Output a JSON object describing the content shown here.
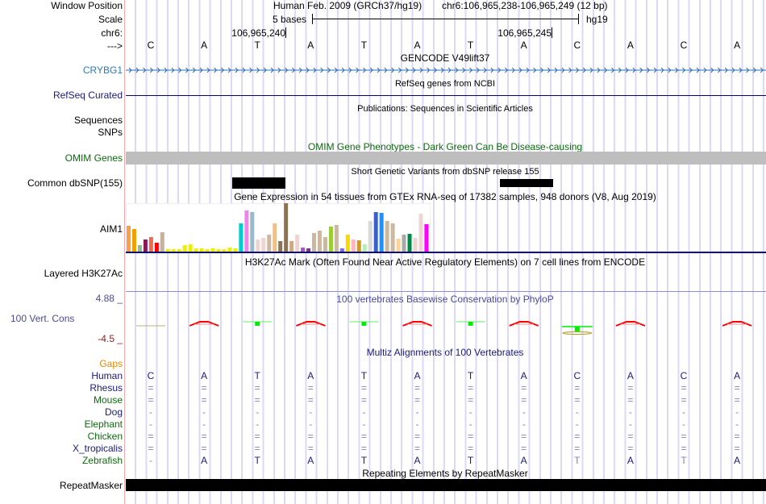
{
  "header": {
    "window_position_label": "Window Position",
    "assembly": "Human Feb. 2009 (GRCh37/hg19)",
    "position": "chr6:106,965,238-106,965,249 (12 bp)",
    "scale_label": "Scale",
    "scale_text": "5 bases",
    "scale_db": "hg19",
    "chrom_label": "chr6:",
    "coord1": "106,965,240",
    "coord2": "106,965,245",
    "strand_label": "--->",
    "bases": [
      "C",
      "A",
      "T",
      "A",
      "T",
      "A",
      "T",
      "A",
      "C",
      "A",
      "C",
      "A"
    ]
  },
  "tracks": {
    "gencode_title": "GENCODE V49lift37",
    "gencode_label": "CRYBG1",
    "refseq_title": "RefSeq genes from NCBI",
    "refseq_label": "RefSeq Curated",
    "pubs_title": "Publications: Sequences in Scientific Articles",
    "pubs_label1": "Sequences",
    "pubs_label2": "SNPs",
    "omim_title": "OMIM Gene Phenotypes - Dark Green Can Be Disease-causing",
    "omim_label": "OMIM Genes",
    "dbsnp_title": "Short Genetic Variants from dbSNP release 155",
    "dbsnp_label": "Common dbSNP(155)",
    "gtex_title": "Gene Expression in 54 tissues from GTEx RNA-seq of 17382 samples, 948 donors (V8, Aug 2019)",
    "gtex_label": "AIM1",
    "h3k27_title": "H3K27Ac Mark (Often Found Near Active Regulatory Elements) on 7 cell lines from ENCODE",
    "h3k27_label": "Layered H3K27Ac",
    "phylop_title": "100 vertebrates Basewise Conservation by PhyloP",
    "phylop_label": "100 Vert. Cons",
    "phylop_max": "4.88 _",
    "phylop_min": "-4.5 _",
    "multiz_title": "Multiz Alignments of 100 Vertebrates",
    "gaps_label": "Gaps",
    "rmsk_title": "Repeating Elements by RepeatMasker",
    "rmsk_label": "RepeatMasker"
  },
  "gtex_values": [
    96,
    84,
    24,
    45,
    54,
    33,
    72,
    9,
    9,
    9,
    24,
    27,
    12,
    12,
    9,
    12,
    9,
    9,
    15,
    12,
    105,
    153,
    147,
    45,
    51,
    63,
    105,
    39,
    180,
    39,
    63,
    15,
    12,
    69,
    78,
    54,
    93,
    99,
    12,
    63,
    45,
    42,
    27,
    114,
    147,
    144,
    114,
    105,
    48,
    63,
    66,
    51,
    141,
    102
  ],
  "gtex_colors": [
    "#f9a04d",
    "#f0a000",
    "#8fbc8f",
    "#8b1a5a",
    "#ee6a50",
    "#ff0000",
    "#c8b09a",
    "#eeee00",
    "#eeee00",
    "#eeee00",
    "#eeee00",
    "#eeee00",
    "#eeee00",
    "#eeee00",
    "#eeee00",
    "#eeee00",
    "#eeee00",
    "#eeee00",
    "#eeee00",
    "#eeee00",
    "#00cdcd",
    "#ee82ee",
    "#9ab8c8",
    "#eed5d2",
    "#eed5d2",
    "#cdb79e",
    "#eec08a",
    "#8b7355",
    "#8b7355",
    "#d2aa7d",
    "#eed5d2",
    "#b04fcf",
    "#7a378b",
    "#cdb79e",
    "#cdb79e",
    "#cdb79e",
    "#9acd32",
    "#cdb79e",
    "#7b68ee",
    "#ffd700",
    "#ffb6c1",
    "#cd9b1d",
    "#b4eeb4",
    "#d9d9d9",
    "#3a5fcd",
    "#1e90ff",
    "#cdb79e",
    "#cdb79e",
    "#ffd39b",
    "#a9a9a9",
    "#008b45",
    "#eed5d2",
    "#eed5d2",
    "#ff00ff"
  ],
  "phylop_marks": [
    "weak",
    "neg",
    "pos",
    "neg",
    "pos",
    "neg",
    "pos",
    "neg",
    "pos-strong",
    "neg",
    "none",
    "neg"
  ],
  "alignment": [
    {
      "species": "Human",
      "color": "#1a1a7a",
      "bases": [
        "C",
        "A",
        "T",
        "A",
        "T",
        "A",
        "T",
        "A",
        "C",
        "A",
        "C",
        "A"
      ]
    },
    {
      "species": "Rhesus",
      "color": "#1a1a7a",
      "bases": [
        "=",
        "=",
        "=",
        "=",
        "=",
        "=",
        "=",
        "=",
        "=",
        "=",
        "=",
        "="
      ]
    },
    {
      "species": "Mouse",
      "color": "#0d6b0d",
      "bases": [
        "=",
        "=",
        "=",
        "=",
        "=",
        "=",
        "=",
        "=",
        "=",
        "=",
        "=",
        "="
      ]
    },
    {
      "species": "Dog",
      "color": "#1a1a7a",
      "bases": [
        "-",
        "-",
        "-",
        "-",
        "-",
        "-",
        "-",
        "-",
        "-",
        "-",
        "-",
        "-"
      ]
    },
    {
      "species": "Elephant",
      "color": "#0d6b0d",
      "bases": [
        "-",
        "-",
        "-",
        "-",
        "-",
        "-",
        "-",
        "-",
        "-",
        "-",
        "-",
        "-"
      ]
    },
    {
      "species": "Chicken",
      "color": "#0d6b0d",
      "bases": [
        "=",
        "=",
        "=",
        "=",
        "=",
        "=",
        "=",
        "=",
        "=",
        "=",
        "=",
        "="
      ]
    },
    {
      "species": "X_tropicalis",
      "color": "#1a1a7a",
      "bases": [
        "=",
        "=",
        "=",
        "=",
        "=",
        "=",
        "=",
        "=",
        "=",
        "=",
        "=",
        "="
      ]
    },
    {
      "species": "Zebrafish",
      "color": "#0d6b0d",
      "bases": [
        "-",
        "A",
        "T",
        "A",
        "T",
        "A",
        "T",
        "A",
        "T",
        "A",
        "T",
        "A"
      ]
    }
  ],
  "colors": {
    "gaps": "#e08a00",
    "nav": "#1a1a7a",
    "phylop": "#4a4a9a",
    "min": "#8b2020"
  }
}
